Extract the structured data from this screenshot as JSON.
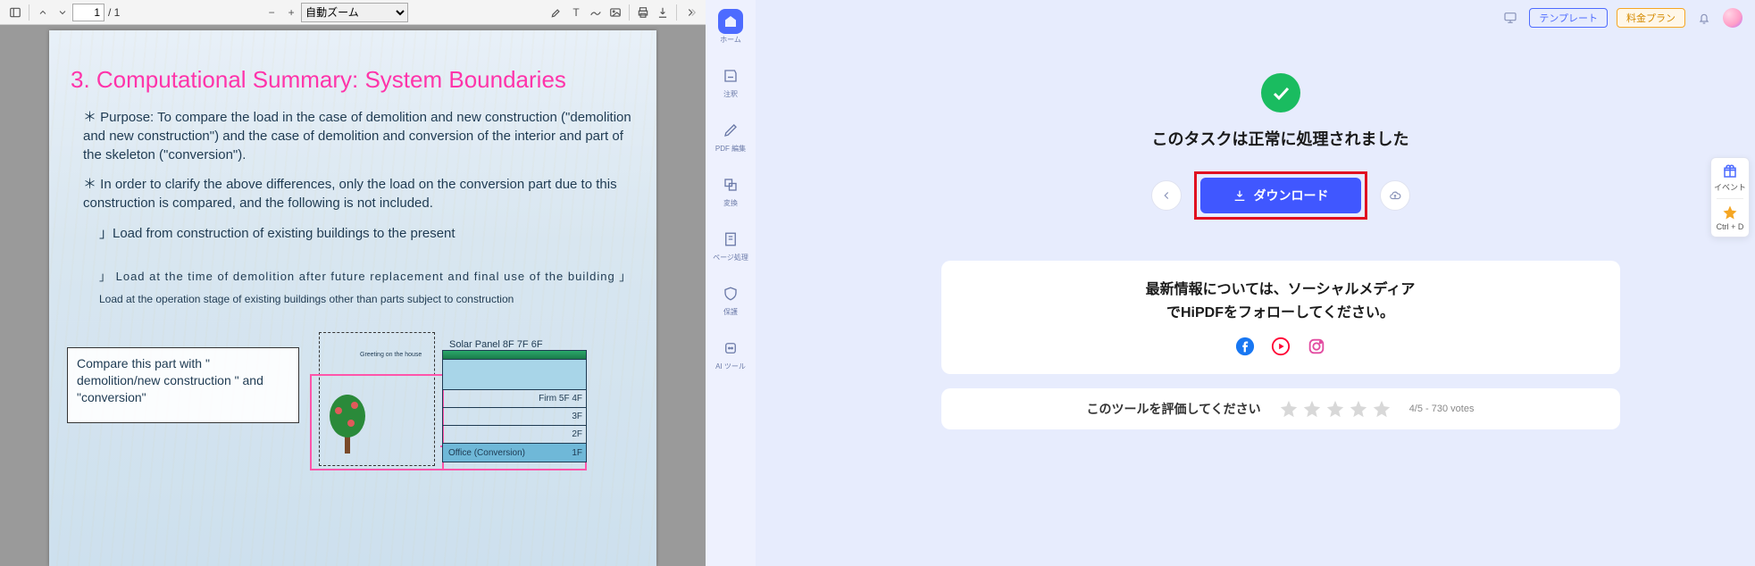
{
  "pdf": {
    "toolbar": {
      "page_current": "1",
      "page_total": "/ 1",
      "zoom_label": "自動ズーム"
    },
    "content": {
      "title": "3. Computational Summary: System Boundaries",
      "p1": "＊ Purpose: To compare the load in the case of demolition and new construction (\"demolition and new construction\") and the case of demolition and conversion of the interior and part of the skeleton (\"conversion\").",
      "p2": "＊ In order to clarify the above differences, only the load on the conversion part due to this construction is compared, and the following is not included.",
      "sub1": "」Load from construction of existing buildings to the present",
      "sub2": "」 Load at the time of demolition after future replacement and final use of the building 」",
      "sub3": "Load at the operation stage of existing buildings other than parts subject to construction",
      "caption": "Compare this part with \" demolition/new construction \" and \"conversion\"",
      "diagram": {
        "solar": "Solar Panel 8F 7F 6F",
        "greeting": "Greeting on the house",
        "rows": [
          "",
          "Firm  5F  4F",
          "3F",
          "2F"
        ],
        "office": "Office (Conversion)",
        "office_floor": "1F"
      }
    }
  },
  "app": {
    "rail": {
      "home": "ホーム",
      "annotate": "注釈",
      "edit": "PDF 編集",
      "convert": "変換",
      "page": "ページ処理",
      "protect": "保護",
      "ai": "AI ツール"
    },
    "topbar": {
      "template": "テンプレート",
      "plan": "料金プラン"
    },
    "success": {
      "message": "このタスクは正常に処理されました",
      "download": "ダウンロード"
    },
    "follow": {
      "line1": "最新情報については、ソーシャルメディア",
      "line2": "でHiPDFをフォローしてください。"
    },
    "rating": {
      "prompt": "このツールを評価してください",
      "score": "4/5 - 730 votes"
    },
    "float": {
      "event": "イベント",
      "shortcut": "Ctrl + D"
    }
  }
}
